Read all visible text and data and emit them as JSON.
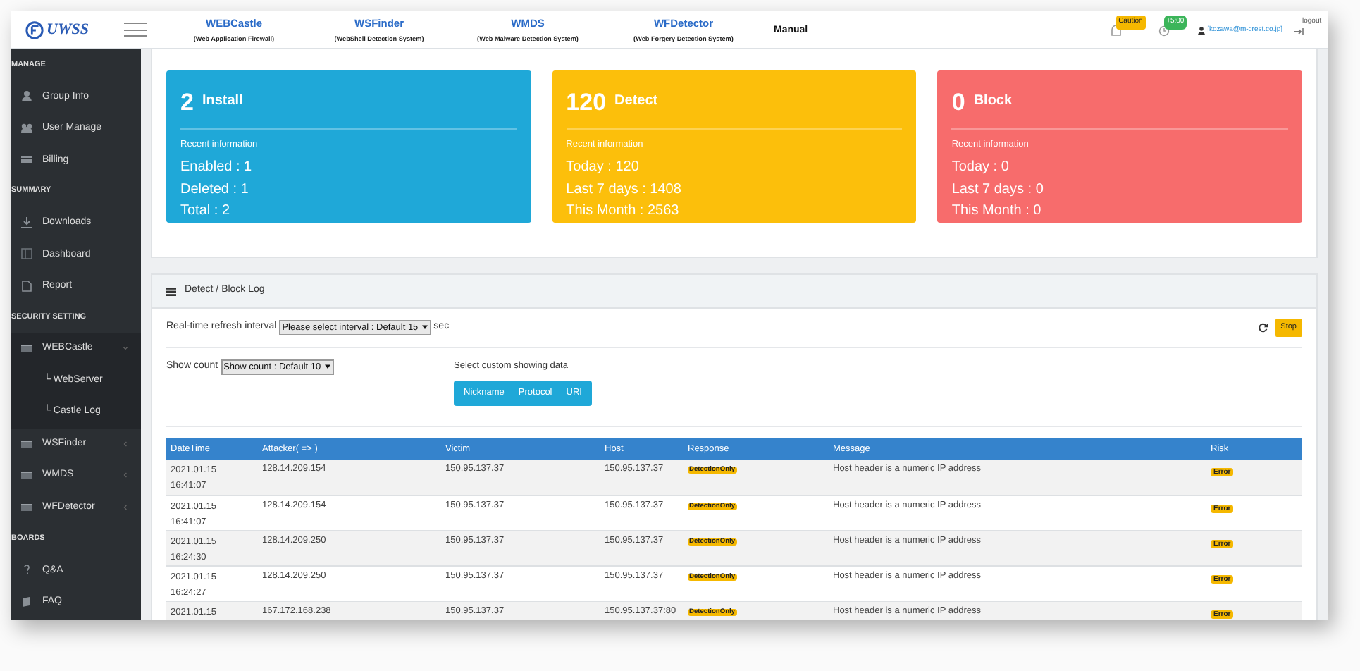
{
  "logo": "UWSS",
  "nav": [
    {
      "title": "WEBCastle",
      "subtitle": "(Web Application Firewall)"
    },
    {
      "title": "WSFinder",
      "subtitle": "(WebShell Detection System)"
    },
    {
      "title": "WMDS",
      "subtitle": "(Web Malware Detection System)"
    },
    {
      "title": "WFDetector",
      "subtitle": "(Web Forgery Detection System)"
    }
  ],
  "manual": "Manual",
  "alerts": {
    "caution": "Caution",
    "time": "+5:00",
    "user": "[kozawa@m-crest.co.jp]",
    "logout": "logout"
  },
  "sidebar": [
    {
      "kind": "section",
      "label": "MANAGE"
    },
    {
      "kind": "item",
      "label": "Group Info"
    },
    {
      "kind": "item",
      "label": "User Manage"
    },
    {
      "kind": "item",
      "label": "Billing"
    },
    {
      "kind": "section",
      "label": "SUMMARY"
    },
    {
      "kind": "item",
      "label": "Downloads"
    },
    {
      "kind": "item",
      "label": "Dashboard"
    },
    {
      "kind": "item",
      "label": "Report"
    },
    {
      "kind": "section",
      "label": "SECURITY SETTING"
    },
    {
      "kind": "group",
      "label": "WEBCastle",
      "expanded": true,
      "children": [
        {
          "label": "└ WebServer"
        },
        {
          "label": "└ Castle Log"
        }
      ]
    },
    {
      "kind": "group",
      "label": "WSFinder",
      "expanded": false
    },
    {
      "kind": "group",
      "label": "WMDS",
      "expanded": false
    },
    {
      "kind": "group",
      "label": "WFDetector",
      "expanded": false
    },
    {
      "kind": "section",
      "label": "BOARDS"
    },
    {
      "kind": "item",
      "label": "Q&A"
    },
    {
      "kind": "item",
      "label": "FAQ"
    }
  ],
  "cards": [
    {
      "count": "2",
      "title": "Install",
      "color": "#1fa8d8",
      "subtitle": "Recent information",
      "lines": [
        "Enabled : 1",
        "Deleted : 1",
        "Total : 2"
      ]
    },
    {
      "count": "120",
      "title": "Detect",
      "color": "#fcbf0b",
      "subtitle": "Recent information",
      "lines": [
        "Today : 120",
        "Last 7 days : 1408",
        "This Month : 2563"
      ]
    },
    {
      "count": "0",
      "title": "Block",
      "color": "#f76c6c",
      "subtitle": "Recent information",
      "lines": [
        "Today : 0",
        "Last 7 days : 0",
        "This Month : 0"
      ]
    }
  ],
  "log": {
    "title": "Detect / Block Log",
    "refresh_label": "Real-time refresh interval",
    "refresh_value": "Please select interval : Default 15",
    "refresh_unit": "sec",
    "stop": "Stop",
    "count_label": "Show count",
    "count_value": "Show count : Default 10",
    "custom_label": "Select custom showing data",
    "custom_buttons": [
      "Nickname",
      "Protocol",
      "URI"
    ],
    "table": {
      "columns": [
        "DateTime",
        "Attacker( => )",
        "Victim",
        "Host",
        "Response",
        "Message",
        "Risk"
      ],
      "rows": [
        {
          "datetime": [
            "2021.01.15",
            "16:41:07"
          ],
          "attacker": "128.14.209.154",
          "victim": "150.95.137.37",
          "host": "150.95.137.37",
          "response": "DetectionOnly",
          "message": "Host header is a numeric IP address",
          "risk": "Error"
        },
        {
          "datetime": [
            "2021.01.15",
            "16:41:07"
          ],
          "attacker": "128.14.209.154",
          "victim": "150.95.137.37",
          "host": "150.95.137.37",
          "response": "DetectionOnly",
          "message": "Host header is a numeric IP address",
          "risk": "Error"
        },
        {
          "datetime": [
            "2021.01.15",
            "16:24:30"
          ],
          "attacker": "128.14.209.250",
          "victim": "150.95.137.37",
          "host": "150.95.137.37",
          "response": "DetectionOnly",
          "message": "Host header is a numeric IP address",
          "risk": "Error"
        },
        {
          "datetime": [
            "2021.01.15",
            "16:24:27"
          ],
          "attacker": "128.14.209.250",
          "victim": "150.95.137.37",
          "host": "150.95.137.37",
          "response": "DetectionOnly",
          "message": "Host header is a numeric IP address",
          "risk": "Error"
        },
        {
          "datetime": [
            "2021.01.15"
          ],
          "attacker": "167.172.168.238",
          "victim": "150.95.137.37",
          "host": "150.95.137.37:80",
          "response": "DetectionOnly",
          "message": "Host header is a numeric IP address",
          "risk": "Error"
        }
      ]
    }
  }
}
